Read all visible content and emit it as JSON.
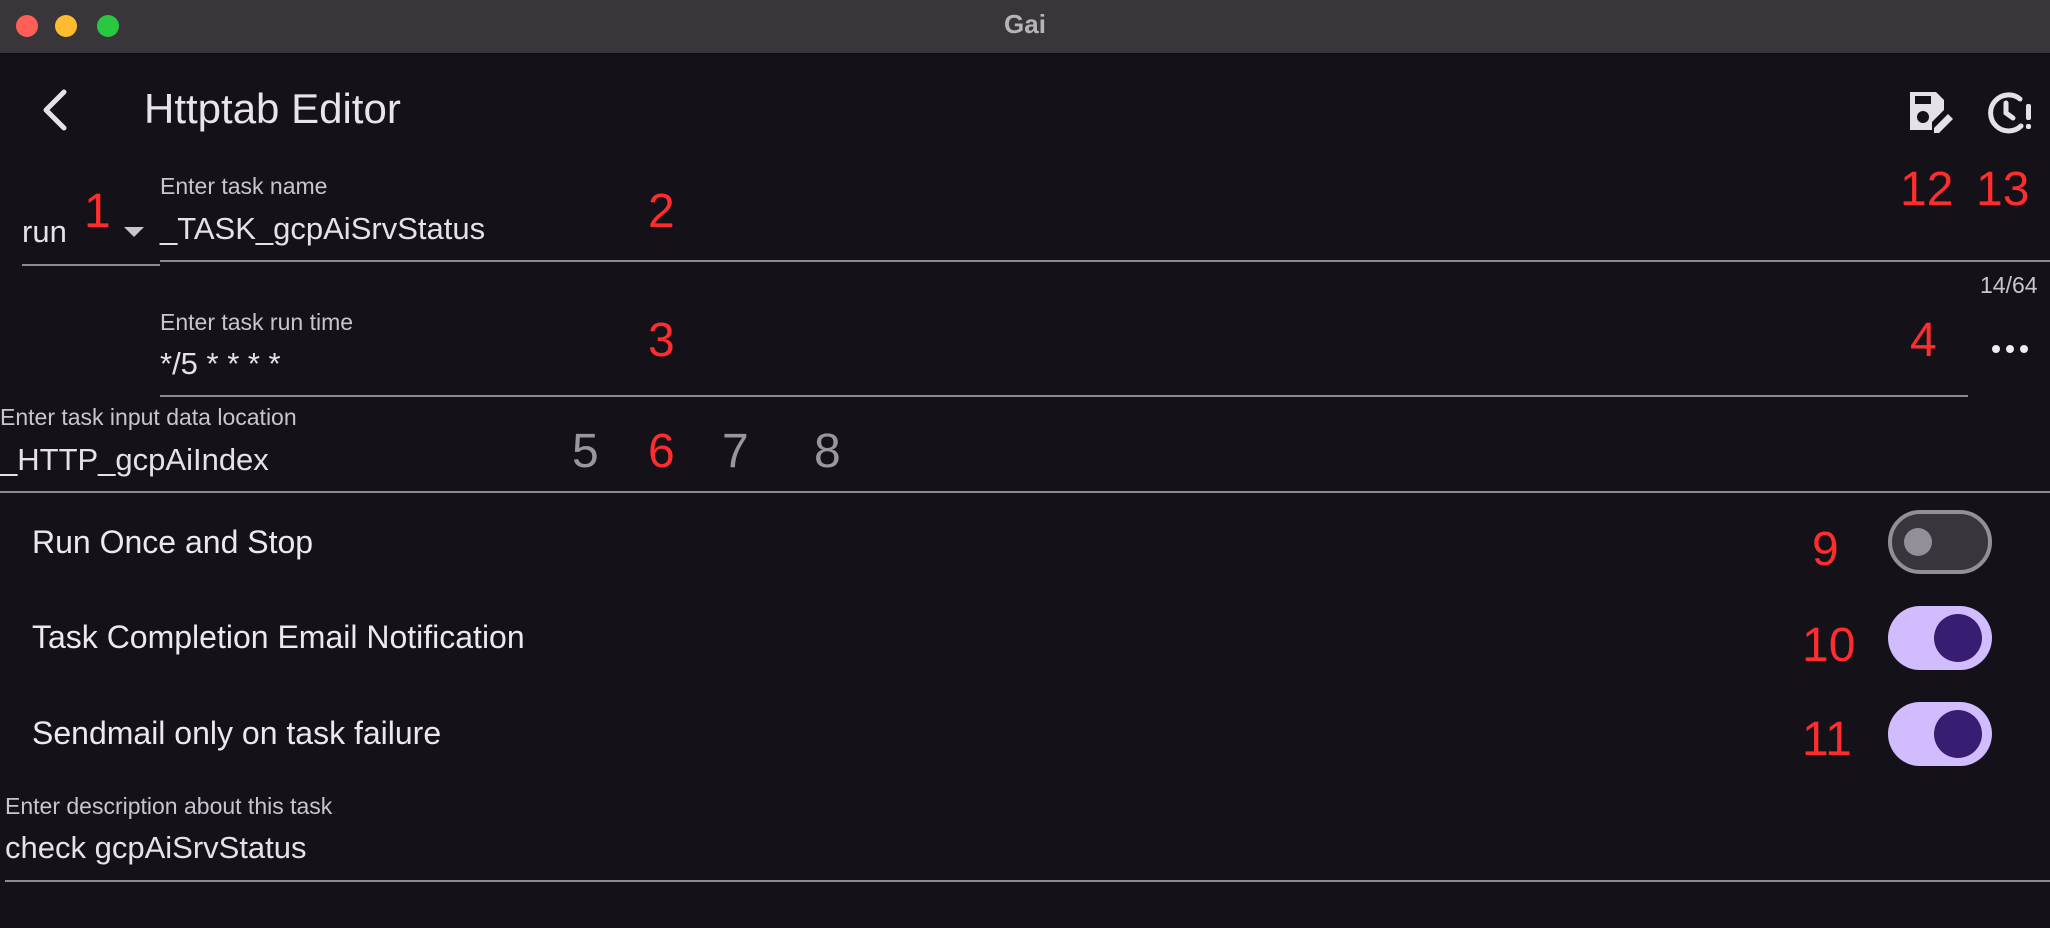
{
  "window": {
    "title": "Gai",
    "traffic_lights": [
      "#ff5f57",
      "#febc2e",
      "#28c840"
    ]
  },
  "header": {
    "back_icon": "chevron-left-icon",
    "title": "Httptab Editor",
    "save_icon": "save-edit-icon",
    "status_icon": "timer-alert-icon"
  },
  "form": {
    "task_type": {
      "value": "run"
    },
    "task_name": {
      "label": "Enter task name",
      "value": "_TASK_gcpAiSrvStatus",
      "counter": "14/64"
    },
    "run_time": {
      "label": "Enter task run time",
      "value": "*/5 * * * *",
      "more_icon": "more-horiz-icon"
    },
    "input_location": {
      "label": "Enter task input data location",
      "value": "_HTTP_gcpAiIndex"
    },
    "toggles": [
      {
        "label": "Run Once and Stop",
        "on": false
      },
      {
        "label": "Task Completion Email Notification",
        "on": true
      },
      {
        "label": "Sendmail only on task failure",
        "on": true
      }
    ],
    "description": {
      "label": "Enter description about this task",
      "value": "check gcpAiSrvStatus"
    }
  },
  "markers": {
    "m1": "1",
    "m2": "2",
    "m3": "3",
    "m4": "4",
    "m5": "5",
    "m6": "6",
    "m7": "7",
    "m8": "8",
    "m9": "9",
    "m10": "10",
    "m11": "11",
    "m12": "12",
    "m13": "13"
  },
  "colors": {
    "background": "#141218",
    "accent": "#d0bcff",
    "accent_dark": "#381e72",
    "marker_red": "#ff2d2d",
    "marker_grey": "#9a979c"
  }
}
